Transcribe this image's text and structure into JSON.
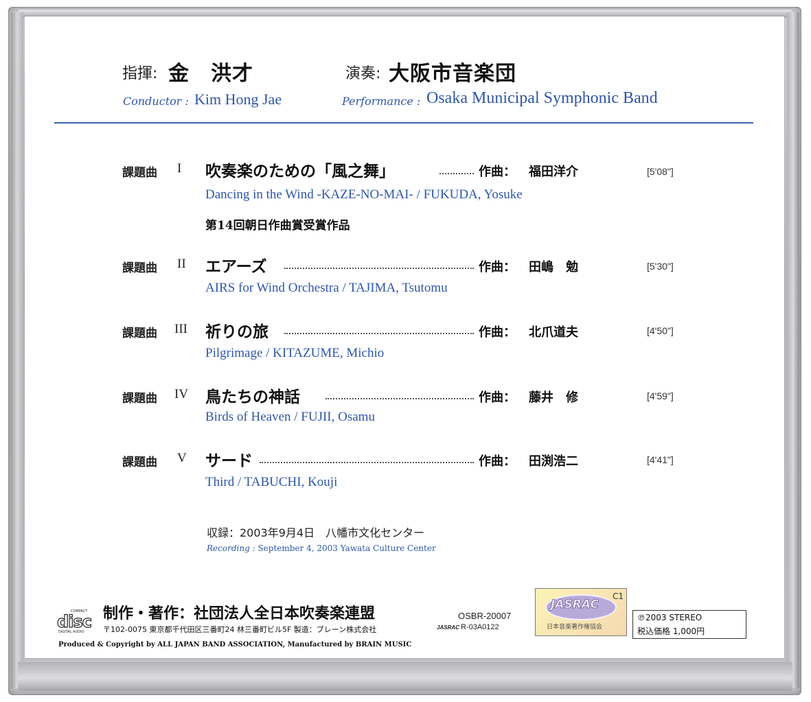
{
  "header": {
    "conductor_label": "指揮:",
    "conductor_name": "金　洪才",
    "performance_label": "演奏:",
    "performance_name": "大阪市音楽団",
    "conductor_en_label": "Conductor :",
    "conductor_en_name": "Kim Hong Jae",
    "performance_en_label": "Performance :",
    "performance_en_name": "Osaka Municipal Symphonic Band"
  },
  "tracks": [
    {
      "label": "課題曲",
      "numeral": "I",
      "title": "吹奏楽のための「風之舞」",
      "composer_label": "作曲：",
      "composer": "福田洋介",
      "time": "[5'08\"]",
      "english": "Dancing in the Wind -KAZE-NO-MAI- / FUKUDA, Yosuke",
      "note": "第14回朝日作曲賞受賞作品"
    },
    {
      "label": "課題曲",
      "numeral": "II",
      "title": "エアーズ",
      "composer_label": "作曲：",
      "composer": "田嶋　勉",
      "time": "[5'30\"]",
      "english": "AIRS for Wind Orchestra / TAJIMA, Tsutomu"
    },
    {
      "label": "課題曲",
      "numeral": "III",
      "title": "祈りの旅",
      "composer_label": "作曲：",
      "composer": "北爪道夫",
      "time": "[4'50\"]",
      "english": "Pilgrimage / KITAZUME, Michio"
    },
    {
      "label": "課題曲",
      "numeral": "IV",
      "title": "鳥たちの神話",
      "composer_label": "作曲：",
      "composer": "藤井　修",
      "time": "[4'59\"]",
      "english": "Birds of Heaven  / FUJII, Osamu"
    },
    {
      "label": "課題曲",
      "numeral": "V",
      "title": "サード",
      "composer_label": "作曲：",
      "composer": "田渕浩二",
      "time": "[4'41\"]",
      "english": "Third / TABUCHI, Kouji"
    }
  ],
  "recording": {
    "jp": "収録：2003年9月4日　八幡市文化センター",
    "en_label": "Recording :",
    "en_text": "September 4, 2003  Yawata Culture Center"
  },
  "footer": {
    "logo_top": "COMPACT",
    "logo_main": "disc",
    "logo_bottom": "DIGITAL AUDIO",
    "production_jp": "制作・著作：社団法人全日本吹奏楽連盟",
    "address": "〒102-0075 東京都千代田区三番町24 林三番町ビル5F 製造：ブレーン株式会社",
    "production_en": "Produced & Copyright by ALL JAPAN BAND ASSOCIATION, Manufactured by BRAIN MUSIC",
    "catalog": "OSBR-20007",
    "jasrac_small": "JASRAC",
    "jasrac_code": "R-03A0122",
    "jasrac_seal_text": "JASRAC",
    "jasrac_seal_class": "C1",
    "jasrac_seal_sub": "日本音楽著作権協会",
    "copyright": "℗2003 STEREO",
    "price": "税込価格 1,000円"
  }
}
